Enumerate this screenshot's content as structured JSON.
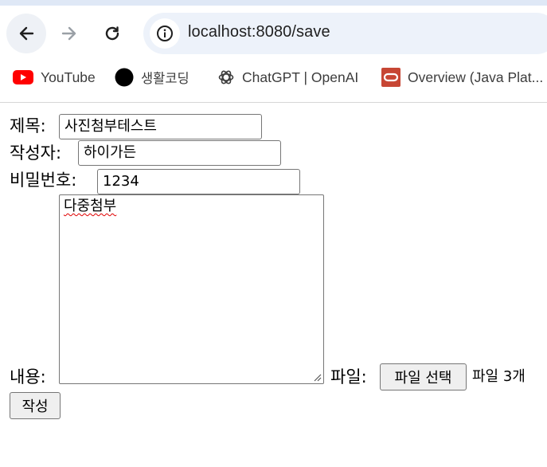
{
  "browser": {
    "url": "localhost:8080/save",
    "bookmarks": [
      {
        "label": "YouTube",
        "icon": "youtube-icon"
      },
      {
        "label": "생활코딩",
        "icon": "black-circle-icon"
      },
      {
        "label": "ChatGPT | OpenAI",
        "icon": "openai-icon"
      },
      {
        "label": "Overview (Java Plat...",
        "icon": "oracle-icon"
      }
    ],
    "colors": {
      "youtube": "#ff0000",
      "oracle": "#c74634"
    }
  },
  "form": {
    "title_label": "제목:",
    "title_value": "사진첨부테스트",
    "writer_label": "작성자:",
    "writer_value": "하이가든",
    "password_label": "비밀번호:",
    "password_value": "1234",
    "contents_label": "내용:",
    "contents_value": "다중첨부",
    "file_label": "파일:",
    "file_button": "파일 선택",
    "file_status": "파일 3개",
    "submit_label": "작성"
  }
}
